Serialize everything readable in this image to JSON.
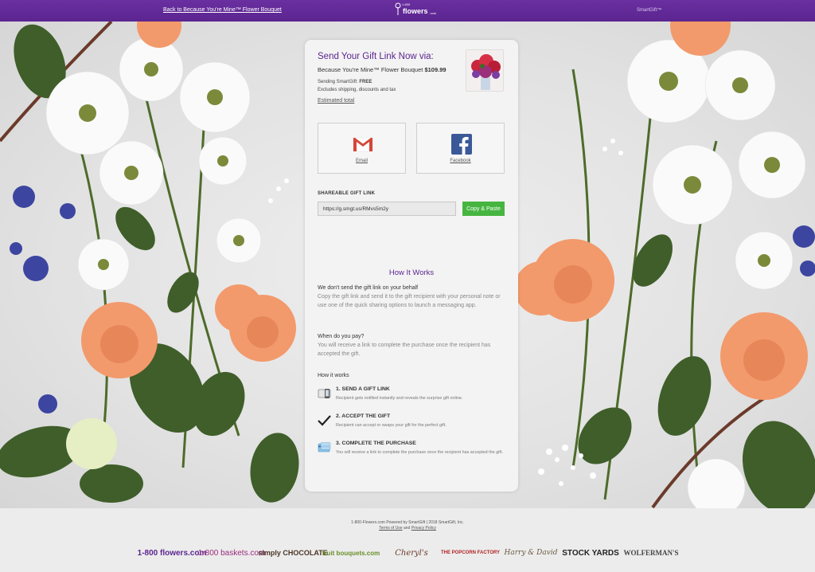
{
  "topbar": {
    "back_link": "Back to Because You're Mine™ Flower Bouquet",
    "logo_small": "1-800",
    "logo_text": "flowers",
    "logo_suffix": ".com",
    "smartgift": "SmartGift™",
    "color": "#5b2590"
  },
  "card": {
    "title": "Send Your Gift Link Now via:",
    "product_name": "Because You're Mine™ Flower Bouquet",
    "product_price": "$109.99",
    "sending_label": "Sending SmartGift:",
    "sending_value": "FREE",
    "excludes": "Excludes shipping, discounts and tax",
    "estimated_total": "Estimated total",
    "share_options": {
      "email_label": "Email",
      "facebook_label": "Facebook"
    },
    "shareable_label": "SHAREABLE GIFT LINK",
    "gift_link": "https://g.smgt.us/RMvs5m2y",
    "copy_button": "Copy & Paste"
  },
  "how_it_works": {
    "title": "How It Works",
    "p1_head": "We don't send the gift link on your behalf",
    "p1_body": "Copy the gift link and send it to the gift recipient with your personal note or use one of the quick sharing options to launch a messaging app.",
    "p2_head": "When do you pay?",
    "p2_body": "You will receive a link to complete the purchase once the recipient has accepted the gift.",
    "p3_head": "How it works",
    "steps": [
      {
        "title": "1. SEND A GIFT LINK",
        "desc": "Recipient gets notified instantly and reveals the surprise gift online.",
        "icon": "phone-icon"
      },
      {
        "title": "2. ACCEPT THE GIFT",
        "desc": "Recipient can accept or swaps your gift for the perfect gift.",
        "icon": "checkmark-icon"
      },
      {
        "title": "3. COMPLETE THE PURCHASE",
        "desc": "You will receive a link to complete the purchase once the recipient has accepted the gift.",
        "icon": "credit-card-icon"
      }
    ]
  },
  "footer": {
    "powered": "1-800-Flowers.com Powered by SmartGift | 2018 SmartGift, Inc.",
    "terms": "Terms of Use",
    "and": "and",
    "privacy": "Privacy Policy",
    "brands": [
      "1-800 flowers.com",
      "1-800 baskets.com",
      "simply CHOCOLATE",
      "fruit bouquets.com",
      "Cheryl's",
      "THE POPCORN FACTORY",
      "Harry & David",
      "STOCK YARDS",
      "WOLFERMAN'S"
    ]
  },
  "colors": {
    "accent": "#5b2590",
    "copy_button": "#45b540",
    "gmail_red": "#d44638",
    "facebook_blue": "#3b5998"
  }
}
